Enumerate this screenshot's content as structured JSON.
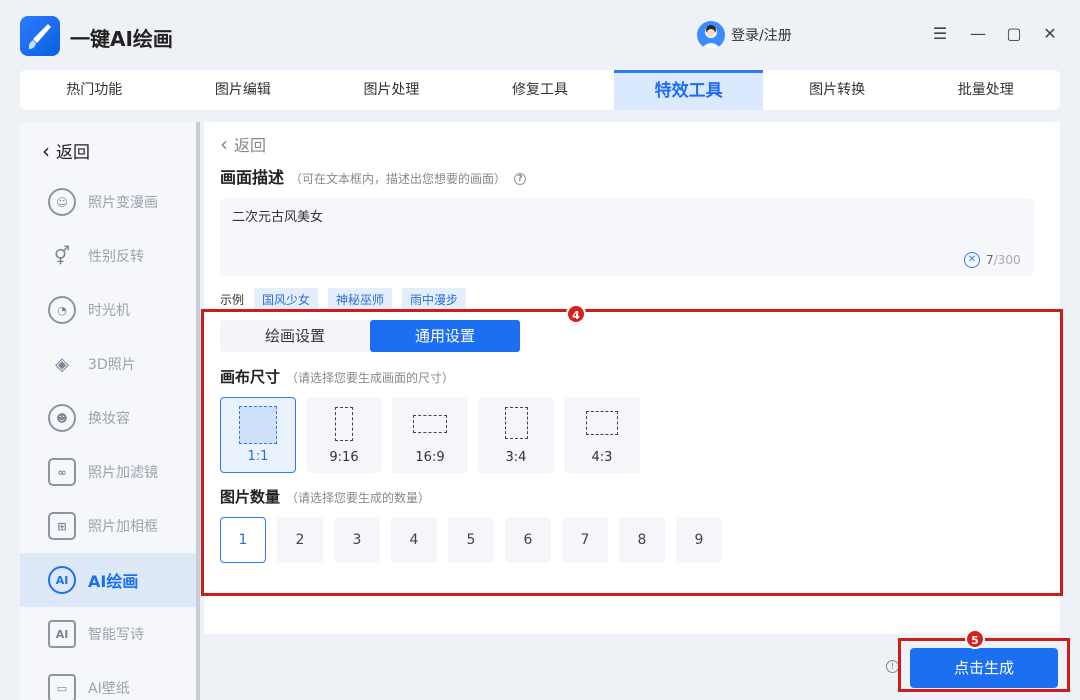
{
  "app": {
    "title": "一键AI绘画"
  },
  "header": {
    "login_label": "登录/注册"
  },
  "window_controls": {
    "menu": "☰",
    "minimize": "—",
    "maximize": "▢",
    "close": "✕"
  },
  "topnav": {
    "tabs": [
      {
        "label": "热门功能"
      },
      {
        "label": "图片编辑"
      },
      {
        "label": "图片处理"
      },
      {
        "label": "修复工具"
      },
      {
        "label": "特效工具",
        "active": true
      },
      {
        "label": "图片转换"
      },
      {
        "label": "批量处理"
      }
    ]
  },
  "sidebar": {
    "back_label": "返回",
    "items": [
      {
        "label": "照片变漫画",
        "icon": "cartoon-face-icon"
      },
      {
        "label": "性别反转",
        "icon": "gender-icon"
      },
      {
        "label": "时光机",
        "icon": "clock-icon"
      },
      {
        "label": "3D照片",
        "icon": "layers-icon"
      },
      {
        "label": "换妆容",
        "icon": "makeup-face-icon"
      },
      {
        "label": "照片加滤镜",
        "icon": "filter-icon"
      },
      {
        "label": "照片加相框",
        "icon": "frame-icon"
      },
      {
        "label": "AI绘画",
        "icon": "ai-palette-icon",
        "active": true
      },
      {
        "label": "智能写诗",
        "icon": "ai-doc-icon"
      },
      {
        "label": "AI壁纸",
        "icon": "wallpaper-icon"
      }
    ]
  },
  "main": {
    "back_label": "返回",
    "description": {
      "title": "画面描述",
      "hint": "（可在文本框内，描述出您想要的画面）",
      "value": "二次元古风美女",
      "count": "7",
      "max": "/300"
    },
    "examples": {
      "label": "示例",
      "chips": [
        "国风少女",
        "神秘巫师",
        "雨中漫步"
      ]
    },
    "settings_tabs": [
      {
        "label": "绘画设置"
      },
      {
        "label": "通用设置",
        "active": true
      }
    ],
    "canvas_size": {
      "title": "画布尺寸",
      "hint": "（请选择您要生成画面的尺寸）",
      "options": [
        "1:1",
        "9:16",
        "16:9",
        "3:4",
        "4:3"
      ],
      "selected": "1:1"
    },
    "quantity": {
      "title": "图片数量",
      "hint": "（请选择您要生成的数量）",
      "options": [
        "1",
        "2",
        "3",
        "4",
        "5",
        "6",
        "7",
        "8",
        "9"
      ],
      "selected": "1"
    }
  },
  "annotations": {
    "badge_4": "4",
    "badge_5": "5"
  },
  "footer": {
    "generate_label": "点击生成"
  },
  "colors": {
    "accent": "#1d6ff2",
    "annotation": "#cc1d1d"
  }
}
